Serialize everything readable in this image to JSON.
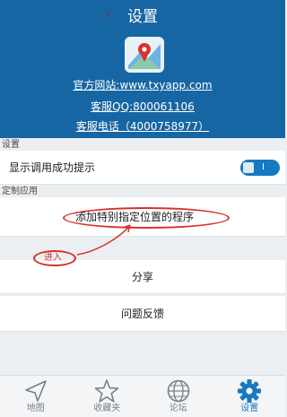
{
  "header": {
    "back_glyph": "‹",
    "title": "设置",
    "website": "官方网站:www.txyapp.com",
    "qq": "客服QQ:800061106",
    "phone": "客服电话（4000758977）",
    "logo_icon": "map-pin-logo-icon"
  },
  "settings": {
    "section_label": "设置",
    "toggle_label": "显示调用成功提示",
    "toggle_on": true,
    "toggle_text": "I"
  },
  "custom": {
    "section_label": "定制应用",
    "add_label": "添加特别指定位置的程序"
  },
  "annotation": {
    "enter_label": "进入",
    "color": "#d6332c"
  },
  "list": {
    "share": "分享",
    "feedback": "问题反馈"
  },
  "tabs": [
    {
      "label": "地图",
      "icon": "navigate-arrow-icon",
      "active": false
    },
    {
      "label": "收藏夹",
      "icon": "star-icon",
      "active": false
    },
    {
      "label": "论坛",
      "icon": "globe-icon",
      "active": false
    },
    {
      "label": "设置",
      "icon": "gear-icon",
      "active": true
    }
  ],
  "colors": {
    "header_bg": "#1766a4",
    "accent": "#1779c0",
    "page_bg": "#eceff2"
  }
}
